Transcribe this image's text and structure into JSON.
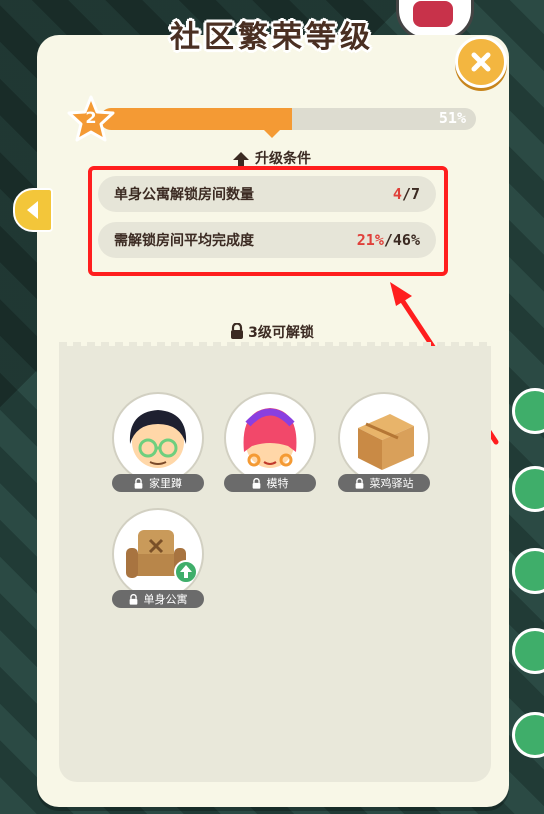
{
  "title": "社区繁荣等级",
  "level": {
    "current": "2",
    "progress_percent": 51,
    "progress_text": "51%"
  },
  "conditions": {
    "header": "升级条件",
    "items": [
      {
        "label": "单身公寓解锁房间数量",
        "value_current": "4",
        "value_rest": "/7"
      },
      {
        "label": "需解锁房间平均完成度",
        "value_current": "21%",
        "value_rest": "/46%"
      }
    ]
  },
  "unlock": {
    "header": "3级可解锁",
    "items": [
      {
        "name": "家里蹲",
        "icon": "nerd-character-icon"
      },
      {
        "name": "模特",
        "icon": "model-character-icon"
      },
      {
        "name": "菜鸡驿站",
        "icon": "package-box-icon"
      },
      {
        "name": "单身公寓",
        "icon": "armchair-upgrade-icon"
      }
    ]
  },
  "colors": {
    "accent": "#f49a34",
    "highlight_box": "#ff1e1e",
    "close": "#f3b640"
  }
}
